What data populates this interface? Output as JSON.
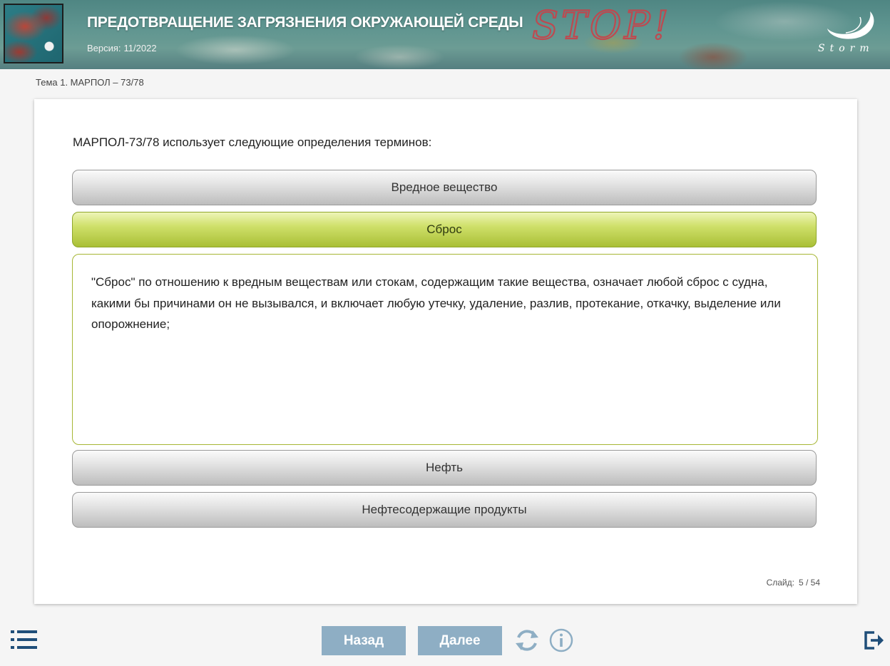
{
  "header": {
    "title": "ПРЕДОТВРАЩЕНИЕ ЗАГРЯЗНЕНИЯ ОКРУЖАЮЩЕЙ СРЕДЫ",
    "version_label": "Версия:",
    "version_value": "11/2022",
    "banner_text": "STOP!",
    "logo_text": "Storm"
  },
  "breadcrumb": "Тема 1. МАРПОЛ – 73/78",
  "slide": {
    "intro": "МАРПОЛ-73/78 использует следующие определения терминов:",
    "terms": [
      {
        "label": "Вредное вещество",
        "active": false
      },
      {
        "label": "Сброс",
        "active": true
      },
      {
        "label": "Нефть",
        "active": false
      },
      {
        "label": "Нефтесодержащие продукты",
        "active": false
      }
    ],
    "definition": "\"Сброс\" по отношению к вредным веществам или стокам, содержащим такие вещества, означает любой сброс с судна, какими бы причинами он не вызывался, и включает любую утечку, удаление, разлив, протекание, откачку, выделение или опорожнение;",
    "counter_label": "Слайд:",
    "counter_value": "5 / 54"
  },
  "nav": {
    "back_label": "Назад",
    "next_label": "Далее"
  },
  "colors": {
    "nav_button": "#8eaec4",
    "active_term": "#b5c83e",
    "icon": "#1f4e79"
  },
  "icons": {
    "menu": "list-icon",
    "reload": "reload-icon",
    "info": "info-icon",
    "exit": "exit-icon"
  }
}
